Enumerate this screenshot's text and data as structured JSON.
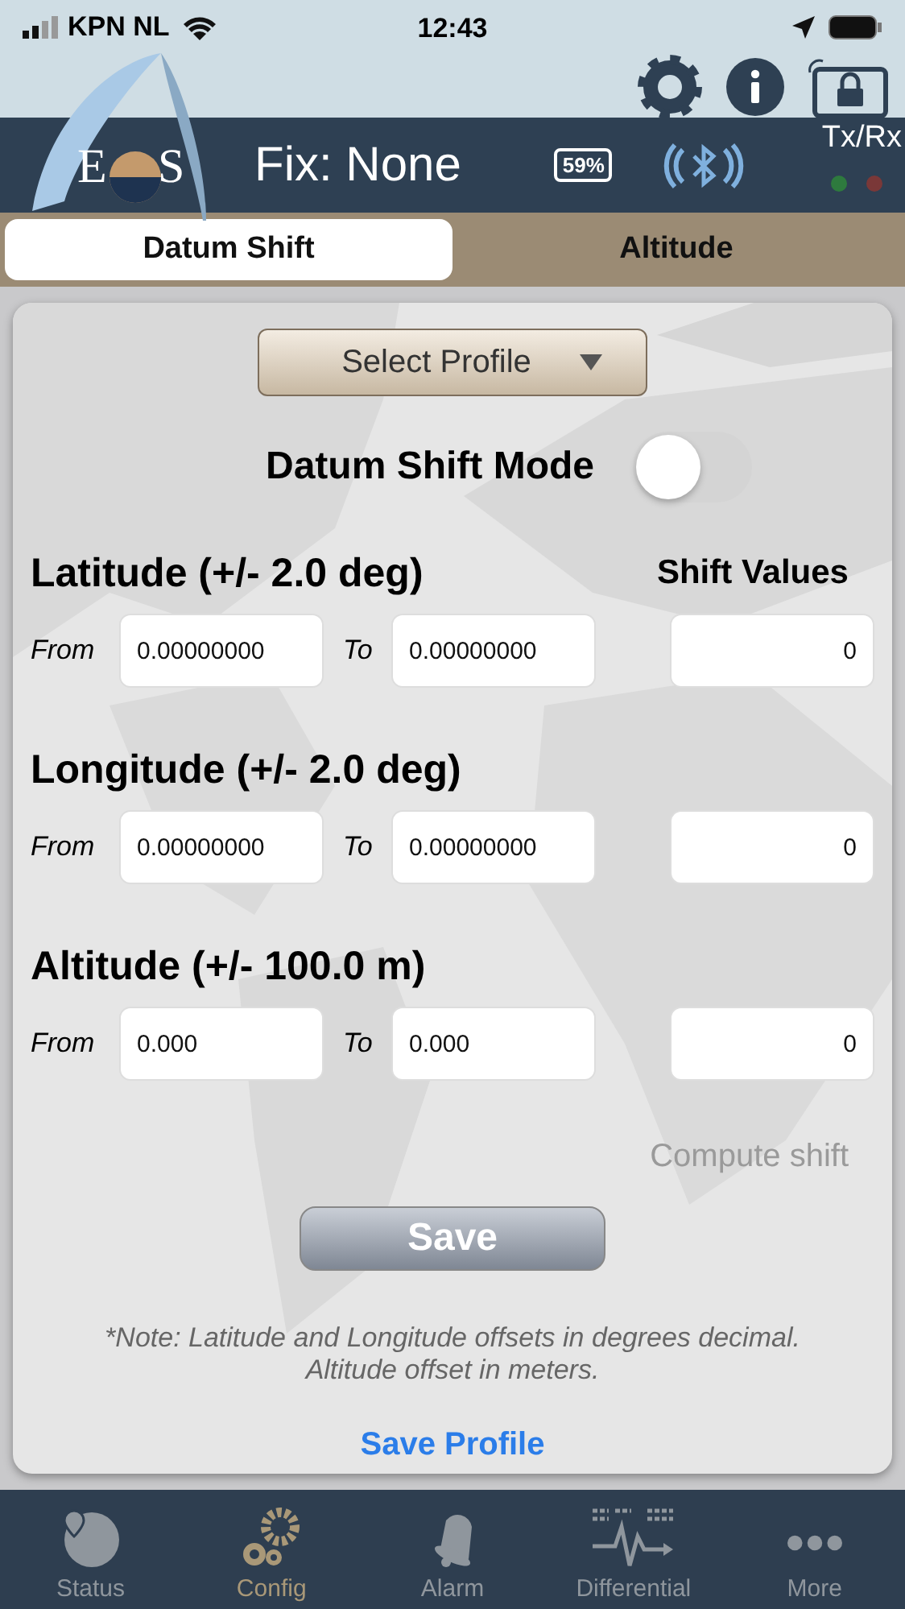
{
  "status_bar": {
    "carrier": "KPN NL",
    "time": "12:43"
  },
  "header": {
    "logo_left": "E",
    "logo_right": "S",
    "fix": "Fix: None",
    "battery": "59%",
    "txrx": "Tx/Rx"
  },
  "tabs": [
    {
      "label": "Datum Shift",
      "selected": true
    },
    {
      "label": "Altitude",
      "selected": false
    }
  ],
  "profile_select": {
    "label": "Select Profile"
  },
  "mode": {
    "label": "Datum Shift Mode",
    "on": false
  },
  "shift_header": "Shift Values",
  "rows": [
    {
      "title": "Latitude (+/- 2.0 deg)",
      "from_label": "From",
      "from": "0.00000000",
      "to_label": "To",
      "to": "0.00000000",
      "shift": "0"
    },
    {
      "title": "Longitude (+/- 2.0 deg)",
      "from_label": "From",
      "from": "0.00000000",
      "to_label": "To",
      "to": "0.00000000",
      "shift": "0"
    },
    {
      "title": "Altitude  (+/- 100.0 m)",
      "from_label": "From",
      "from": "0.000",
      "to_label": "To",
      "to": "0.000",
      "shift": "0"
    }
  ],
  "compute": {
    "label": "Compute shift",
    "disabled": true
  },
  "save": "Save",
  "note": "*Note: Latitude and Longitude offsets in degrees decimal. Altitude offset in meters.",
  "save_profile": "Save Profile",
  "nav": [
    {
      "label": "Status",
      "kind": "globe",
      "selected": false
    },
    {
      "label": "Config",
      "kind": "gears",
      "selected": true
    },
    {
      "label": "Alarm",
      "kind": "bell",
      "selected": false
    },
    {
      "label": "Differential",
      "kind": "wave",
      "selected": false
    },
    {
      "label": "More",
      "kind": "dots",
      "selected": false
    }
  ]
}
